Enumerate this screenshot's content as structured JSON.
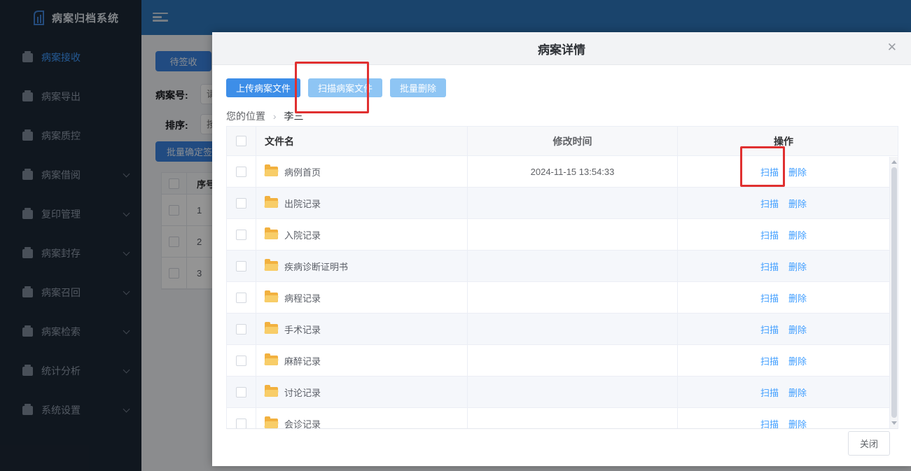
{
  "app": {
    "title": "病案归档系统"
  },
  "topbar": {
    "collapse_icon": "menu-fold-icon"
  },
  "sidebar": {
    "items": [
      {
        "label": "病案接收",
        "icon": "inbox-icon",
        "active": true,
        "has_children": false
      },
      {
        "label": "病案导出",
        "icon": "export-icon",
        "active": false,
        "has_children": false
      },
      {
        "label": "病案质控",
        "icon": "qc-box-icon",
        "active": false,
        "has_children": false
      },
      {
        "label": "病案借阅",
        "icon": "library-icon",
        "active": false,
        "has_children": true
      },
      {
        "label": "复印管理",
        "icon": "copy-icon",
        "active": false,
        "has_children": true
      },
      {
        "label": "病案封存",
        "icon": "seal-icon",
        "active": false,
        "has_children": true
      },
      {
        "label": "病案召回",
        "icon": "recall-icon",
        "active": false,
        "has_children": true
      },
      {
        "label": "病案检索",
        "icon": "search-icon",
        "active": false,
        "has_children": true
      },
      {
        "label": "统计分析",
        "icon": "gear-icon",
        "active": false,
        "has_children": true
      },
      {
        "label": "系统设置",
        "icon": "gear-icon",
        "active": false,
        "has_children": true
      }
    ]
  },
  "background": {
    "tab_label": "待签收",
    "filters": [
      {
        "label": "病案号:",
        "placeholder": "请"
      },
      {
        "label": "排序:",
        "placeholder": "按"
      }
    ],
    "batch_button": "批量确定签收",
    "table": {
      "header_seq": "序号",
      "rows": [
        "1",
        "2",
        "3"
      ]
    }
  },
  "modal": {
    "title": "病案详情",
    "close_icon": "✕",
    "toolbar": {
      "upload": "上传病案文件",
      "scan": "扫描病案文件",
      "batch_delete": "批量删除"
    },
    "breadcrumb": {
      "prefix": "您的位置",
      "separator": "›",
      "current": "李三"
    },
    "table": {
      "headers": {
        "name": "文件名",
        "time": "修改时间",
        "actions": "操作"
      },
      "row_actions": {
        "scan": "扫描",
        "delete": "删除"
      },
      "rows": [
        {
          "name": "病例首页",
          "time": "2024-11-15 13:54:33"
        },
        {
          "name": "出院记录",
          "time": ""
        },
        {
          "name": "入院记录",
          "time": ""
        },
        {
          "name": "疾病诊断证明书",
          "time": ""
        },
        {
          "name": "病程记录",
          "time": ""
        },
        {
          "name": "手术记录",
          "time": ""
        },
        {
          "name": "麻醉记录",
          "time": ""
        },
        {
          "name": "讨论记录",
          "time": ""
        },
        {
          "name": "会诊记录",
          "time": ""
        }
      ]
    },
    "footer": {
      "close": "关闭"
    }
  },
  "annotations": {
    "highlight_color": "#e03030"
  },
  "colors": {
    "topbar": "#2e75ba",
    "sidebar": "#1d2836",
    "primary_button": "#3d8ee8",
    "light_button": "#8ec5f4",
    "link": "#409eff",
    "folder": "#f2b13f"
  }
}
